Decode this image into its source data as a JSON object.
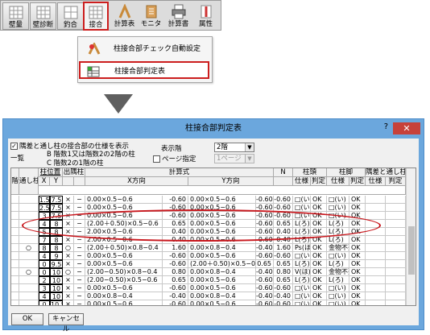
{
  "toolbar": {
    "buttons": [
      {
        "label": "壁量",
        "icon": "wall-amount-icon"
      },
      {
        "label": "壁診断",
        "icon": "wall-diagnosis-icon"
      },
      {
        "label": "釣合",
        "icon": "balance-icon"
      },
      {
        "label": "接合",
        "icon": "joint-icon"
      },
      {
        "label": "計算表",
        "icon": "calc-table-icon"
      },
      {
        "label": "モニタ",
        "icon": "monitor-icon"
      },
      {
        "label": "計算書",
        "icon": "printer-icon"
      },
      {
        "label": "属性",
        "icon": "attribute-icon"
      }
    ]
  },
  "menu": {
    "items": [
      {
        "label": "柱接合部チェック自動設定"
      },
      {
        "label": "柱接合部判定表"
      }
    ]
  },
  "dialog": {
    "title": "柱接合部判定表",
    "help": "?",
    "close": "✕",
    "checkbox_label": "隅差と通し柱の接合部の仕様を表示",
    "checkbox_checked": true,
    "list_label": "一覧",
    "note1": "B 階数1又は階数2の2階の柱",
    "note2": "C 階数2の1階の柱",
    "floor_label": "表示階",
    "floor_value": "2階",
    "page_label": "ページ指定",
    "page_value": "1ページ",
    "headers": {
      "kai": "階",
      "toshi": "通し柱",
      "pos": "柱位置",
      "x": "X",
      "y": "Y",
      "dekado": "出隅柱",
      "kei": "計算式",
      "xdir": "X方向",
      "ydir": "Y方向",
      "n": "N",
      "chutou": "柱頭",
      "chukyaku": "柱脚",
      "siyou": "仕様",
      "hantei": "判定",
      "sumi": "隅差と通し柱",
      "siyou2": "仕様",
      "hantei2": "判定"
    },
    "rows": [
      {
        "kai": "",
        "toshi": "",
        "x": "1.5",
        "y": "7.5",
        "a": "×",
        "b": "−",
        "xf": "0.00×0.5−0.6",
        "xv": "-0.60",
        "yf": "0.00×0.5−0.6",
        "yv": "-0.60",
        "n": "-0.60",
        "hs": "□(い)",
        "hj": "OK",
        "ks": "□(い)",
        "kj": "OK"
      },
      {
        "kai": "",
        "toshi": "",
        "x": "2.5",
        "y": "7.5",
        "a": "×",
        "b": "−",
        "xf": "0.00×0.5−0.6",
        "xv": "-0.60",
        "yf": "0.00×0.5−0.6",
        "yv": "-0.60",
        "n": "-0.60",
        "hs": "□(い)",
        "hj": "OK",
        "ks": "□(い)",
        "kj": "OK"
      },
      {
        "kai": "",
        "toshi": "",
        "x": "3",
        "y": "7.5",
        "a": "×",
        "b": "−",
        "xf": "0.00×0.5−0.6",
        "xv": "-0.60",
        "yf": "0.00×0.5−0.6",
        "yv": "-0.60",
        "n": "-0.60",
        "hs": "□(い)",
        "hj": "OK",
        "ks": "□(い)",
        "kj": "OK"
      },
      {
        "kai": "",
        "toshi": "",
        "x": "4",
        "y": "8",
        "a": "×",
        "b": "−",
        "xf": "(2.00＋0.50)×0.5−0.6",
        "xv": "0.65",
        "yf": "0.00×0.5−0.6",
        "yv": "-0.60",
        "n": "0.65",
        "hs": "L(ろ)",
        "hj": "OK",
        "ks": "L(ろ)",
        "kj": "OK"
      },
      {
        "kai": "",
        "toshi": "",
        "x": "5",
        "y": "8",
        "a": "×",
        "b": "−",
        "xf": "2.00×0.5−0.6",
        "xv": "0.40",
        "yf": "0.00×0.5−0.6",
        "yv": "-0.60",
        "n": "0.40",
        "hs": "L(ろ)",
        "hj": "OK",
        "ks": "L(ろ)",
        "kj": "OK"
      },
      {
        "kai": "",
        "toshi": "",
        "x": "7",
        "y": "8",
        "a": "×",
        "b": "−",
        "xf": "2.00×0.5−0.6",
        "xv": "0.40",
        "yf": "0.00×0.5−0.6",
        "yv": "-0.60",
        "n": "0.40",
        "hs": "L(ろ)",
        "hj": "OK",
        "ks": "L(ろ)",
        "kj": "OK"
      },
      {
        "kai": "",
        "toshi": "○",
        "x": "8",
        "y": "8",
        "a": "○",
        "b": "−",
        "xf": "(2.00＋0.50)×0.8−0.4",
        "xv": "1.60",
        "yf": "0.00×0.8−0.4",
        "yv": "-0.40",
        "n": "1.60",
        "hs": "Ps(ほ)",
        "hj": "OK",
        "ks": "金物不要",
        "kj": "OK"
      },
      {
        "kai": "",
        "toshi": "",
        "x": "4",
        "y": "9",
        "a": "×",
        "b": "−",
        "xf": "0.00×0.5−0.6",
        "xv": "-0.60",
        "yf": "0.00×0.5−0.6",
        "yv": "-0.60",
        "n": "-0.60",
        "hs": "□(い)",
        "hj": "OK",
        "ks": "□(い)",
        "kj": "OK"
      },
      {
        "kai": "",
        "toshi": "",
        "x": "0",
        "y": "9.5",
        "a": "×",
        "b": "−",
        "xf": "0.00×0.5−0.6",
        "xv": "-0.60",
        "yf": "(2.00＋0.50)×0.5−0.6",
        "yv": "0.65",
        "n": "0.65",
        "hs": "L(ろ)",
        "hj": "OK",
        "ks": "L(ろ)",
        "kj": "OK"
      },
      {
        "kai": "",
        "toshi": "○",
        "x": "0",
        "y": "10",
        "a": "○",
        "b": "−",
        "xf": "(2.00−0.50)×0.8−0.4",
        "xv": "0.80",
        "yf": "0.00×0.8−0.4",
        "yv": "-0.40",
        "n": "0.80",
        "hs": "V(ほ)",
        "hj": "OK",
        "ks": "金物不要",
        "kj": "OK"
      },
      {
        "kai": "",
        "toshi": "",
        "x": "2",
        "y": "10",
        "a": "×",
        "b": "−",
        "xf": "(2.00−0.50)×0.5−0.6",
        "xv": "0.65",
        "yf": "0.00×0.5−0.6",
        "yv": "-0.60",
        "n": "0.65",
        "hs": "L(ろ)",
        "hj": "OK",
        "ks": "L(ろ)",
        "kj": "OK"
      },
      {
        "kai": "",
        "toshi": "",
        "x": "3",
        "y": "10",
        "a": "×",
        "b": "−",
        "xf": "0.00×0.5−0.6",
        "xv": "-0.60",
        "yf": "0.00×0.5−0.6",
        "yv": "-0.60",
        "n": "-0.60",
        "hs": "□(い)",
        "hj": "OK",
        "ks": "□(い)",
        "kj": "OK"
      },
      {
        "kai": "",
        "toshi": "",
        "x": "4",
        "y": "10",
        "a": "×",
        "b": "−",
        "xf": "0.00×0.8−0.4",
        "xv": "-0.40",
        "yf": "0.00×0.8−0.4",
        "yv": "-0.40",
        "n": "-0.40",
        "hs": "□(い)",
        "hj": "OK",
        "ks": "□(い)",
        "kj": "OK"
      },
      {
        "kai": "",
        "toshi": "",
        "x": "0",
        "y": "10.5",
        "a": "×",
        "b": "−",
        "xf": "0.00×0.5−0.6",
        "xv": "-0.60",
        "yf": "0.00×0.5−0.6",
        "yv": "-0.60",
        "n": "-0.60",
        "hs": "□(い)",
        "hj": "OK",
        "ks": "□(い)",
        "kj": "OK"
      }
    ],
    "ok": "OK",
    "cancel": "キャンセル"
  }
}
